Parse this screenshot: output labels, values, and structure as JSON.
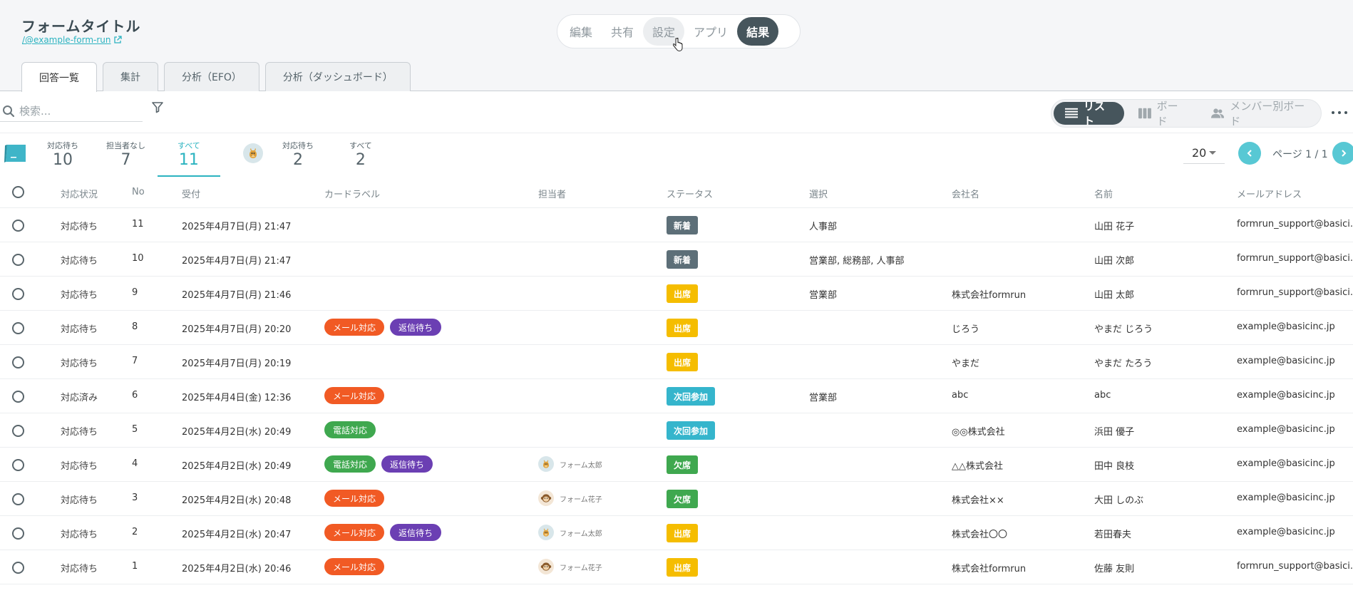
{
  "header": {
    "title": "フォームタイトル",
    "link": "/@example-form-run",
    "modes": [
      "編集",
      "共有",
      "設定",
      "アプリ",
      "結果"
    ],
    "active_mode": "結果",
    "hover_mode": "設定",
    "tabs": [
      "回答一覧",
      "集計",
      "分析（EFO）",
      "分析（ダッシュボード）"
    ],
    "active_tab": "回答一覧"
  },
  "toolbar": {
    "search_placeholder": "検索...",
    "views": [
      "リスト",
      "ボード",
      "メンバー別ボード"
    ],
    "active_view": "リスト"
  },
  "counters": {
    "group1": [
      {
        "label": "対応待ち",
        "count": "10"
      },
      {
        "label": "担当者なし",
        "count": "7"
      },
      {
        "label": "すべて",
        "count": "11"
      }
    ],
    "group2": [
      {
        "label": "対応待ち",
        "count": "2"
      },
      {
        "label": "すべて",
        "count": "2"
      }
    ],
    "per_page": "20",
    "page_info": "ページ 1 / 1"
  },
  "table": {
    "columns": [
      "対応状況",
      "No",
      "受付",
      "カードラベル",
      "担当者",
      "ステータス",
      "選択",
      "会社名",
      "名前",
      "メールアドレス"
    ],
    "rows": [
      {
        "state": "対応待ち",
        "no": "11",
        "date": "2025年4月7日(月) 21:47",
        "labels": [],
        "assignee": null,
        "status": "新着",
        "select": "人事部",
        "company": "",
        "name": "山田 花子",
        "email": "formrun_support@basici..."
      },
      {
        "state": "対応待ち",
        "no": "10",
        "date": "2025年4月7日(月) 21:47",
        "labels": [],
        "assignee": null,
        "status": "新着",
        "select": "営業部, 総務部, 人事部",
        "company": "",
        "name": "山田 次郎",
        "email": "formrun_support@basici..."
      },
      {
        "state": "対応待ち",
        "no": "9",
        "date": "2025年4月7日(月) 21:46",
        "labels": [],
        "assignee": null,
        "status": "出席",
        "select": "営業部",
        "company": "株式会社formrun",
        "name": "山田 太郎",
        "email": "formrun_support@basici..."
      },
      {
        "state": "対応待ち",
        "no": "8",
        "date": "2025年4月7日(月) 20:20",
        "labels": [
          "メール対応",
          "返信待ち"
        ],
        "assignee": null,
        "status": "出席",
        "select": "",
        "company": "じろう",
        "name": "やまだ じろう",
        "email": "example@basicinc.jp"
      },
      {
        "state": "対応待ち",
        "no": "7",
        "date": "2025年4月7日(月) 20:19",
        "labels": [],
        "assignee": null,
        "status": "出席",
        "select": "",
        "company": "やまだ",
        "name": "やまだ たろう",
        "email": "example@basicinc.jp"
      },
      {
        "state": "対応済み",
        "no": "6",
        "date": "2025年4月4日(金) 12:36",
        "labels": [
          "メール対応"
        ],
        "assignee": null,
        "status": "次回参加",
        "select": "営業部",
        "company": "abc",
        "name": "abc",
        "email": "example@basicinc.jp"
      },
      {
        "state": "対応待ち",
        "no": "5",
        "date": "2025年4月2日(水) 20:49",
        "labels": [
          "電話対応"
        ],
        "assignee": null,
        "status": "次回参加",
        "select": "",
        "company": "◎◎株式会社",
        "name": "浜田 優子",
        "email": "example@basicinc.jp"
      },
      {
        "state": "対応待ち",
        "no": "4",
        "date": "2025年4月2日(水) 20:49",
        "labels": [
          "電話対応",
          "返信待ち"
        ],
        "assignee": {
          "name": "フォーム太郎",
          "icon": "giraffe"
        },
        "status": "欠席",
        "select": "",
        "company": "△△株式会社",
        "name": "田中 良枝",
        "email": "example@basicinc.jp"
      },
      {
        "state": "対応待ち",
        "no": "3",
        "date": "2025年4月2日(水) 20:48",
        "labels": [
          "メール対応"
        ],
        "assignee": {
          "name": "フォーム花子",
          "icon": "monkey"
        },
        "status": "欠席",
        "select": "",
        "company": "株式会社××",
        "name": "大田 しのぶ",
        "email": "example@basicinc.jp"
      },
      {
        "state": "対応待ち",
        "no": "2",
        "date": "2025年4月2日(水) 20:47",
        "labels": [
          "メール対応",
          "返信待ち"
        ],
        "assignee": {
          "name": "フォーム太郎",
          "icon": "giraffe"
        },
        "status": "出席",
        "select": "",
        "company": "株式会社〇〇",
        "name": "若田春夫",
        "email": "example@basicinc.jp"
      },
      {
        "state": "対応待ち",
        "no": "1",
        "date": "2025年4月2日(水) 20:46",
        "labels": [
          "メール対応"
        ],
        "assignee": {
          "name": "フォーム花子",
          "icon": "monkey"
        },
        "status": "出席",
        "select": "",
        "company": "株式会社formrun",
        "name": "佐藤 友則",
        "email": "formrun_support@basici..."
      }
    ]
  },
  "colors": {
    "label_mail": "#f15a24",
    "label_reply": "#6b3fb3",
    "label_phone": "#3fa84f",
    "status_new": "#5d6f78",
    "status_attend": "#f5bd00",
    "status_next": "#35b5cc",
    "status_absent": "#3fa84f",
    "accent": "#2bb3c0"
  }
}
